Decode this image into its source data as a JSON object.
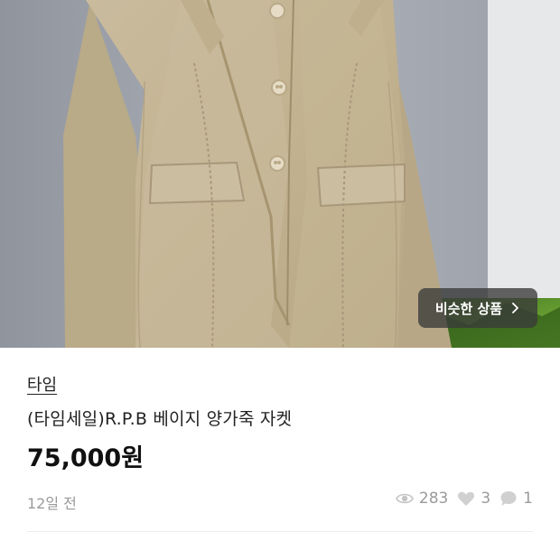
{
  "photo": {
    "alt_subject": "jacket-photo"
  },
  "similar_button": {
    "label": "비슷한 상품"
  },
  "product": {
    "shop_name": "타임",
    "title": "(타임세일)R.P.B 베이지 양가죽 자켓",
    "price": "75,000원",
    "posted": "12일 전"
  },
  "stats": {
    "views": "283",
    "likes": "3",
    "chats": "1"
  },
  "icons": {
    "views": "eye-icon",
    "likes": "heart-icon",
    "chats": "chat-icon",
    "similar": "chevron-right-icon"
  },
  "colors": {
    "text_muted": "#9a9a9a",
    "button_bg": "#3a3a3a"
  }
}
